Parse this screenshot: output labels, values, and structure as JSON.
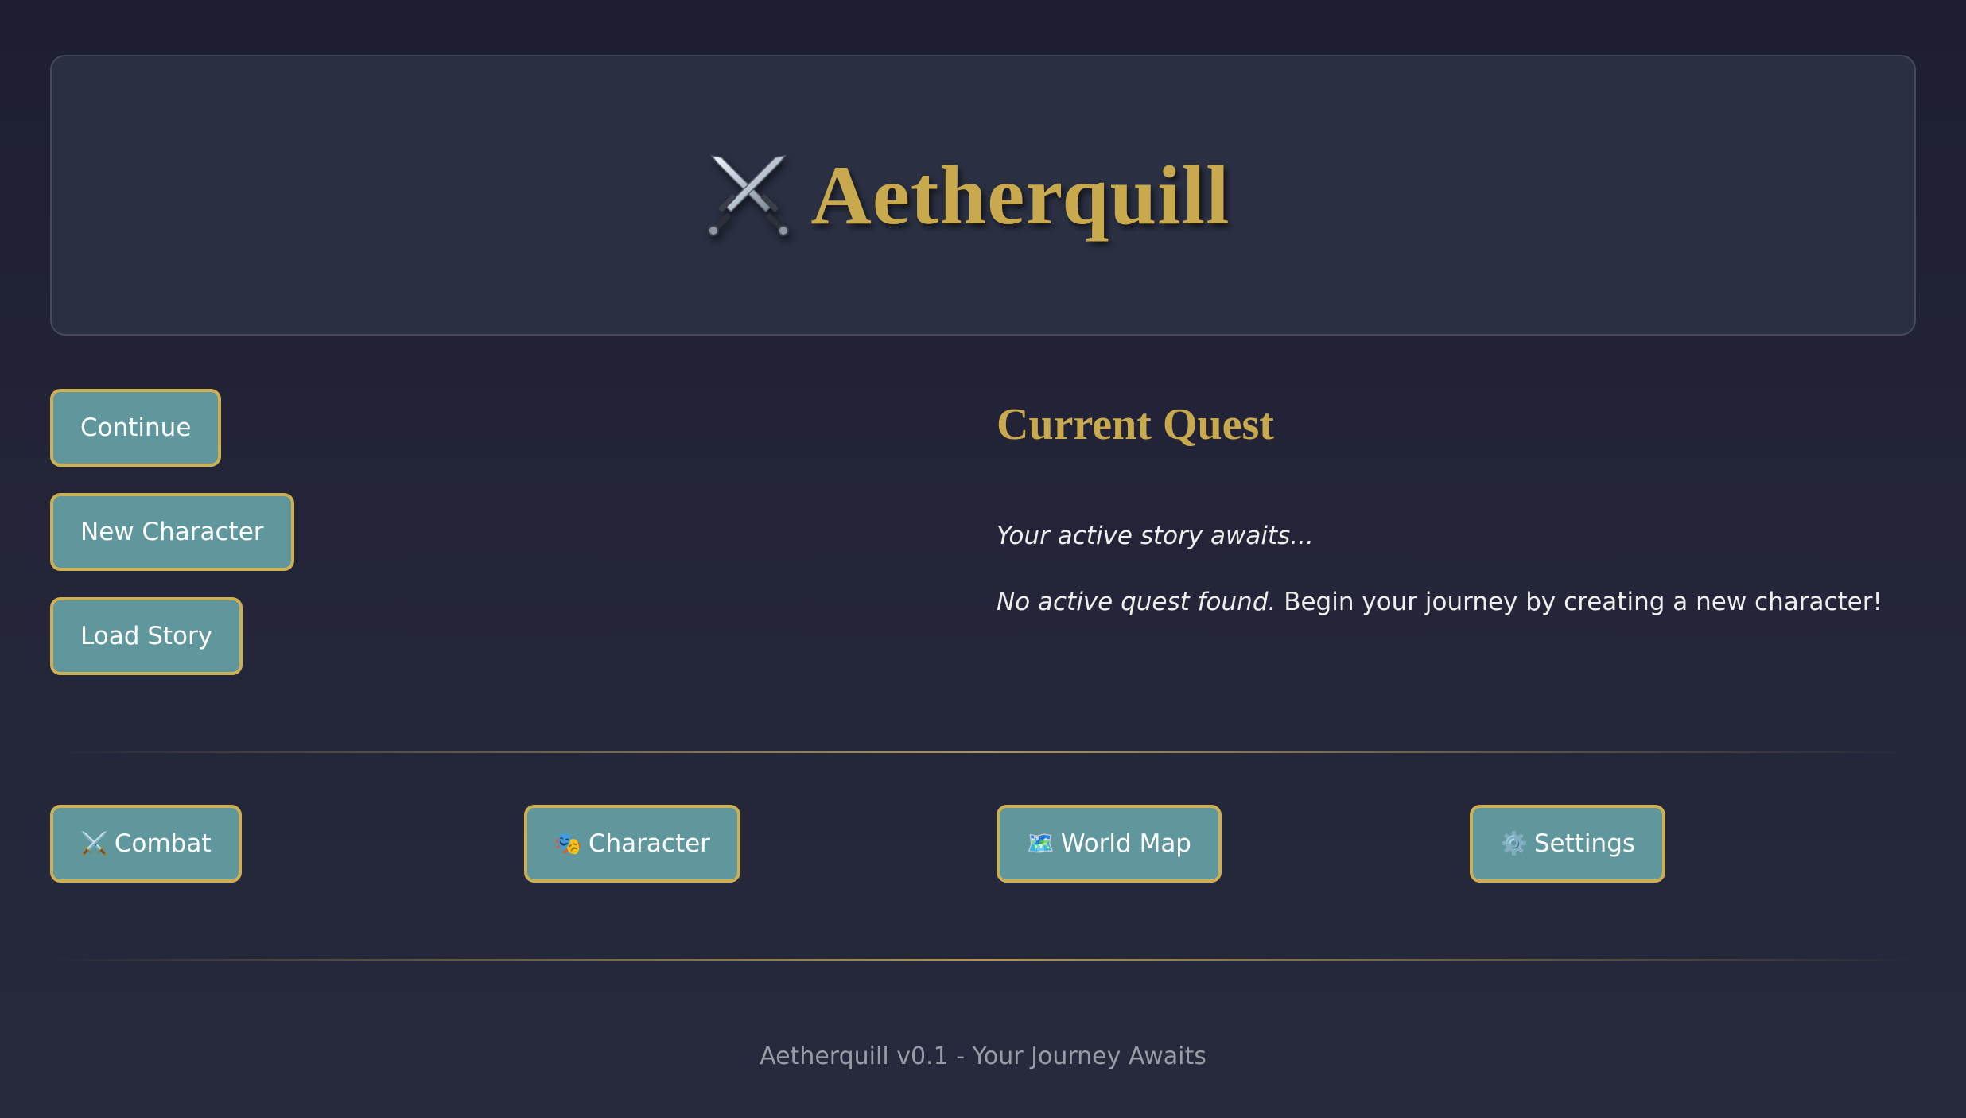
{
  "header": {
    "title": "Aetherquill",
    "icon": "crossed-swords-icon"
  },
  "menu": {
    "continue_label": "Continue",
    "new_character_label": "New Character",
    "load_story_label": "Load Story"
  },
  "quest": {
    "title": "Current Quest",
    "subtitle": "Your active story awaits...",
    "message_emphasis": "No active quest found.",
    "message_rest": " Begin your journey by creating a new character!"
  },
  "nav": {
    "combat": {
      "icon": "⚔️",
      "label": "Combat"
    },
    "character": {
      "icon": "🎭",
      "label": "Character"
    },
    "world_map": {
      "icon": "🗺️",
      "label": "World Map"
    },
    "settings": {
      "icon": "⚙️",
      "label": "Settings"
    }
  },
  "footer": {
    "text": "Aetherquill v0.1 - Your Journey Awaits"
  },
  "colors": {
    "accent_gold": "#c9a94d",
    "button_teal": "#5f979d",
    "background": "#1f2035"
  }
}
